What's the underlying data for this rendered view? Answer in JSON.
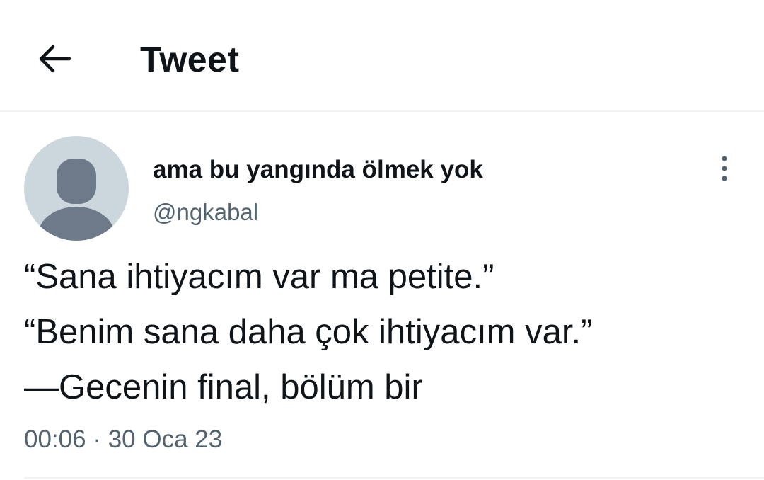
{
  "header": {
    "back_icon": "arrow-left-icon",
    "title": "Tweet"
  },
  "tweet": {
    "author": {
      "display_name": "ama bu yangında ölmek yok",
      "handle": "@ngkabal",
      "avatar_icon": "default-profile-avatar"
    },
    "more_icon": "vertical-dots-icon",
    "lines": [
      "“Sana ihtiyacım var ma petite.”",
      "“Benim sana daha çok ihtiyacım var.”",
      "—Gecenin final, bölüm bir"
    ],
    "time": "00:06",
    "separator": "·",
    "date": "30 Oca 23"
  },
  "colors": {
    "text_primary": "#0f1419",
    "text_secondary": "#536471",
    "divider": "#eff3f4",
    "avatar_bg": "#ccd6dd",
    "avatar_figure": "#6c7a89"
  }
}
